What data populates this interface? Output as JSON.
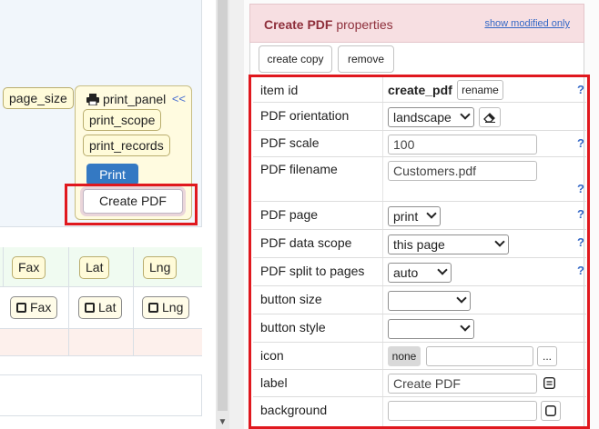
{
  "canvas": {
    "chips": {
      "page_size": "page_size",
      "print_panel": "print_panel",
      "collapse": "<<",
      "print_scope": "print_scope",
      "print_records": "print_records",
      "print_button": "Print",
      "create_pdf_button": "Create PDF"
    },
    "grid": {
      "header_cells": [
        "Fax",
        "Lat",
        "Lng"
      ],
      "field_cells": [
        "Fax",
        "Lat",
        "Lng"
      ]
    }
  },
  "panel": {
    "title_bold": "Create PDF",
    "title_rest": " properties",
    "show_modified": "show modified only",
    "buttons": {
      "create_copy": "create copy",
      "remove": "remove"
    },
    "help_glyph": "?",
    "rows": {
      "item_id": {
        "label": "item id",
        "value": "create_pdf",
        "action": "rename"
      },
      "orientation": {
        "label": "PDF orientation",
        "value": "landscape"
      },
      "scale": {
        "label": "PDF scale",
        "value": "100"
      },
      "filename": {
        "label": "PDF filename",
        "value": "Customers.pdf"
      },
      "page": {
        "label": "PDF page",
        "value": "print"
      },
      "data_scope": {
        "label": "PDF data scope",
        "value": "this page"
      },
      "split": {
        "label": "PDF split to pages",
        "value": "auto"
      },
      "button_size": {
        "label": "button size",
        "value": ""
      },
      "button_style": {
        "label": "button style",
        "value": ""
      },
      "icon": {
        "label": "icon",
        "none_label": "none",
        "value": "",
        "more": "..."
      },
      "label": {
        "label": "label",
        "value": "Create PDF"
      },
      "background": {
        "label": "background",
        "value": ""
      }
    }
  },
  "colors": {
    "highlight": "#e0181e",
    "panel_header_bg": "#f7dfe2",
    "panel_title": "#8e2f3b",
    "link": "#3468c6",
    "print_button": "#3479c3"
  }
}
